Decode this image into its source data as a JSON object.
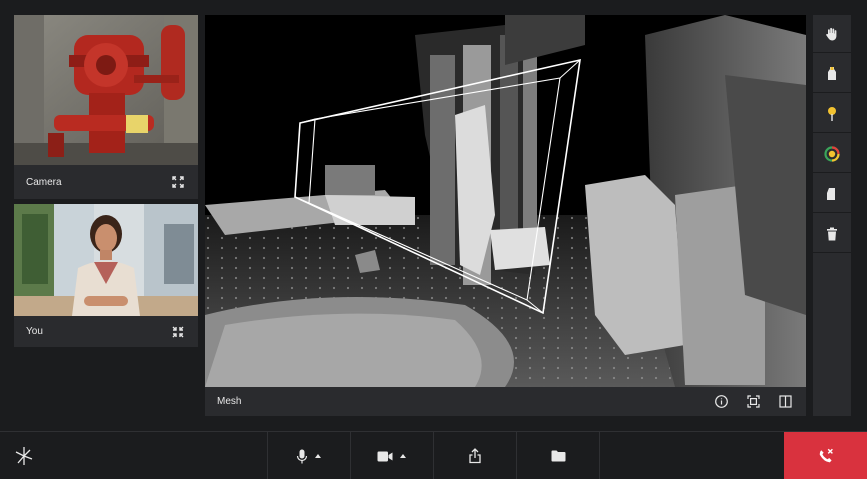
{
  "feeds": {
    "camera": {
      "label": "Camera",
      "action_icon": "expand-icon"
    },
    "you": {
      "label": "You",
      "action_icon": "collapse-icon"
    }
  },
  "mesh": {
    "label": "Mesh",
    "actions": [
      "info-icon",
      "scan-icon",
      "split-view-icon"
    ]
  },
  "tools": [
    "hand-icon",
    "marker-icon",
    "pin-icon",
    "color-picker-icon",
    "eraser-icon",
    "trash-icon"
  ],
  "bottom_bar": {
    "buttons": [
      "logo-icon",
      "microphone-icon",
      "video-camera-icon",
      "share-screen-icon",
      "folder-icon",
      "end-call-icon"
    ]
  },
  "colors": {
    "accent_yellow": "#f2c230",
    "end_call_red": "#d9323e",
    "panel_bg": "#2a2b2e",
    "app_bg": "#1b1c1e"
  }
}
